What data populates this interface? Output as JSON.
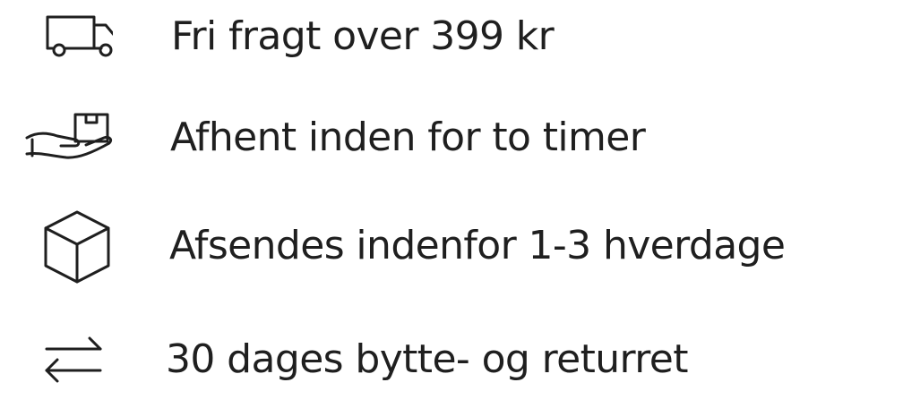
{
  "usps": [
    {
      "icon": "truck-icon",
      "label": "Fri fragt over 399 kr"
    },
    {
      "icon": "hand-package-icon",
      "label": "Afhent inden for to timer"
    },
    {
      "icon": "box-icon",
      "label": "Afsendes indenfor 1-3 hverdage"
    },
    {
      "icon": "exchange-arrows-icon",
      "label": "30 dages bytte- og returret"
    }
  ],
  "colors": {
    "text": "#1f1f1f",
    "icon_stroke": "#1f1f1f",
    "background": "#ffffff"
  }
}
